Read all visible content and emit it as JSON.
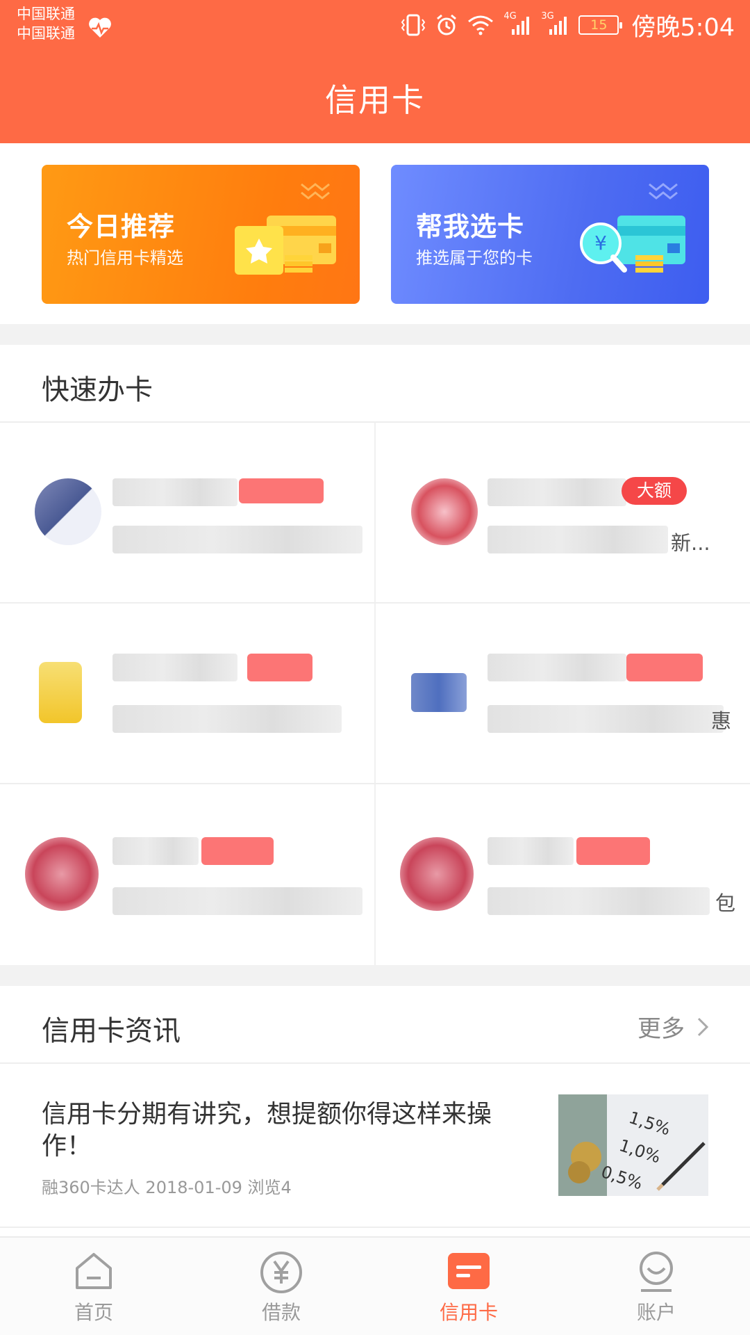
{
  "status_bar": {
    "carrier_1": "中国联通",
    "carrier_2": "中国联通",
    "network_1": "4G",
    "network_2": "3G",
    "battery": "15",
    "time": "傍晚5:04"
  },
  "header": {
    "title": "信用卡"
  },
  "banners": [
    {
      "title": "今日推荐",
      "subtitle": "热门信用卡精选",
      "color": "#ff8a12"
    },
    {
      "title": "帮我选卡",
      "subtitle": "推选属于您的卡",
      "color": "#4f6df2"
    }
  ],
  "quick_apply": {
    "title": "快速办卡",
    "cards": [
      {
        "badge": "",
        "desc_tail": ""
      },
      {
        "badge": "大额",
        "desc_tail": "新..."
      },
      {
        "badge": "",
        "desc_tail": ""
      },
      {
        "badge": "",
        "desc_tail": "惠"
      },
      {
        "badge": "",
        "desc_tail": ""
      },
      {
        "badge": "",
        "desc_tail": "包"
      }
    ]
  },
  "news": {
    "title": "信用卡资讯",
    "more": "更多",
    "article": {
      "headline": "信用卡分期有讲究，想提额你得这样来操作！",
      "meta": "融360卡达人 2018-01-09 浏览4",
      "image_labels": [
        "1,5%",
        "1,0%",
        "0,5%"
      ]
    }
  },
  "bottom_nav": [
    {
      "label": "首页",
      "icon": "home-icon",
      "active": false
    },
    {
      "label": "借款",
      "icon": "yuan-icon",
      "active": false
    },
    {
      "label": "信用卡",
      "icon": "credit-card-icon",
      "active": true
    },
    {
      "label": "账户",
      "icon": "account-icon",
      "active": false
    }
  ],
  "colors": {
    "brand": "#fe6a45",
    "badge_red": "#f54748",
    "inactive": "#9a9a9a"
  }
}
